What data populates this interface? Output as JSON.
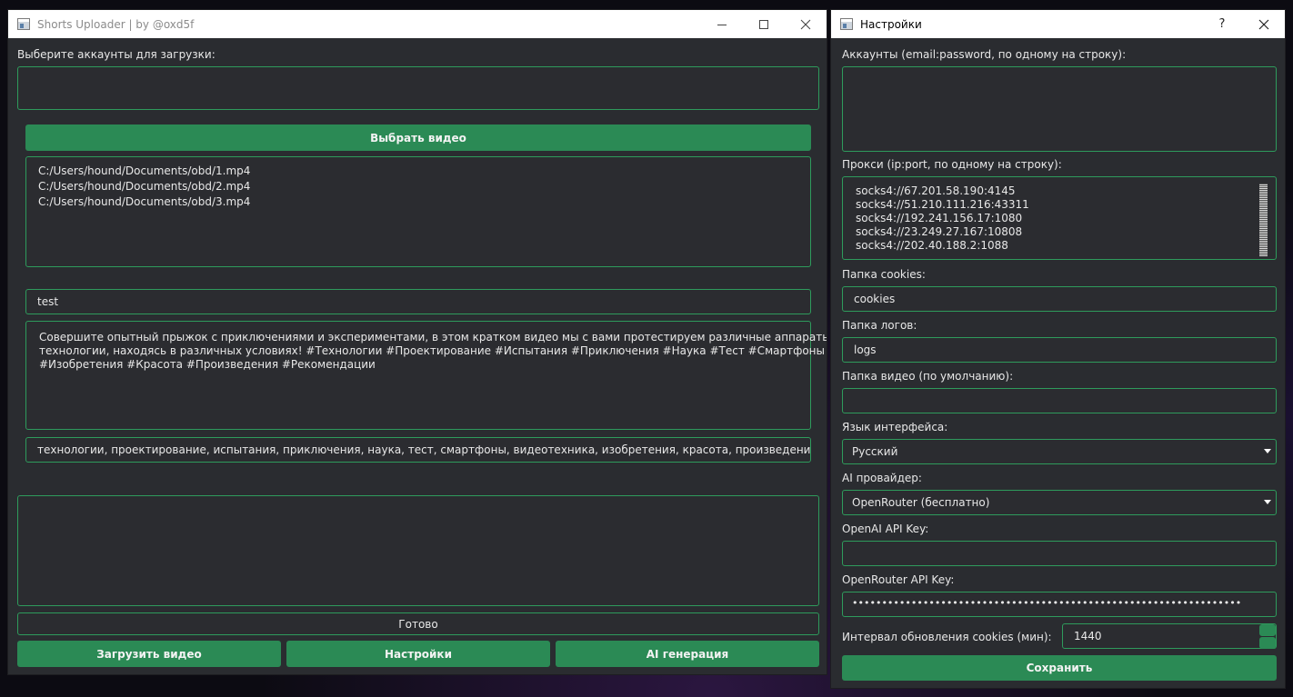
{
  "main_window": {
    "title": "Shorts Uploader | by @oxd5f",
    "accounts_label": "Выберите аккаунты для загрузки:",
    "select_video_button": "Выбрать видео",
    "video_files": [
      "C:/Users/hound/Documents/obd/1.mp4",
      "C:/Users/hound/Documents/obd/2.mp4",
      "C:/Users/hound/Documents/obd/3.mp4"
    ],
    "video_title": "test",
    "description_lines": [
      "Совершите опытный прыжок с приключениями и экспериментами, в этом кратком видео мы с вами протестируем различные аппараты и",
      "технологии, находясь в различных условиях! #Технологии #Проектирование #Испытания #Приключения #Наука #Тест #Смартфоны #Видеотехника",
      "#Изобретения #Красота #Произведения #Рекомендации"
    ],
    "tags": "технологии, проектирование, испытания, приключения, наука, тест, смартфоны, видеотехника, изобретения, красота, произведения, рекомендации",
    "status": "Готово",
    "upload_button": "Загрузить видео",
    "settings_button": "Настройки",
    "ai_button": "AI генерация"
  },
  "settings_window": {
    "title": "Настройки",
    "help": "?",
    "accounts_label": "Аккаунты (email:password, по одному на строку):",
    "proxy_label": "Прокси (ip:port, по одному на строку):",
    "proxies": [
      "socks4://67.201.58.190:4145",
      "socks4://51.210.111.216:43311",
      "socks4://192.241.156.17:1080",
      "socks4://23.249.27.167:10808",
      "socks4://202.40.188.2:1088"
    ],
    "cookies_label": "Папка cookies:",
    "cookies_value": "cookies",
    "logs_label": "Папка логов:",
    "logs_value": "logs",
    "video_folder_label": "Папка видео (по умолчанию):",
    "video_folder_value": "",
    "language_label": "Язык интерфейса:",
    "language_value": "Русский",
    "ai_provider_label": "AI провайдер:",
    "ai_provider_value": "OpenRouter (бесплатно)",
    "openai_key_label": "OpenAI API Key:",
    "openai_key_value": "",
    "openrouter_key_label": "OpenRouter API Key:",
    "openrouter_key_value": "••••••••••••••••••••••••••••••••••••••••••••••••••••••••••••••••••",
    "cookie_interval_label": "Интервал обновления cookies (мин):",
    "cookie_interval_value": "1440",
    "save_button": "Сохранить"
  },
  "colors": {
    "accent": "#2b8a55",
    "border": "#2e9b5c",
    "panel": "#2a2c30"
  }
}
